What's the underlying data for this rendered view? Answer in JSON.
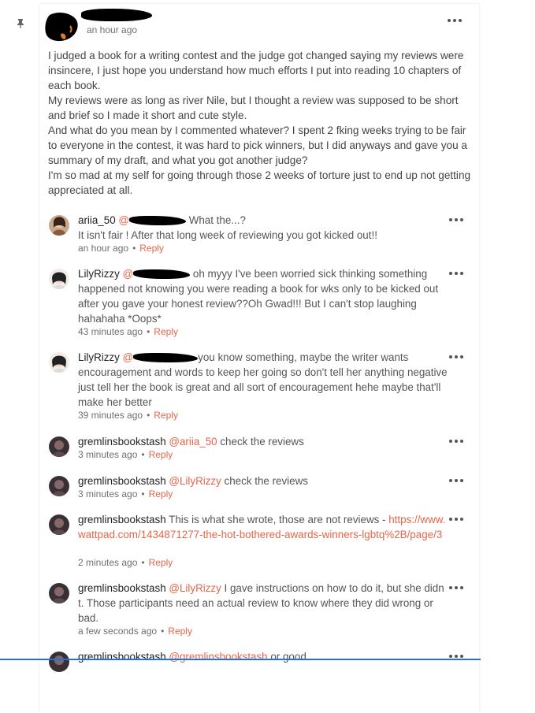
{
  "main": {
    "time": "an hour ago",
    "body": "I judged a book for a writing contest and the judge got changed saying my reviews were insincere, I just hope you understand how much efforts I put into reading 10 chapters of each book.\nMy reviews were as long as river Nile, but I thought a review was supposed to be short and brief so I made it short and cute style.\nAnd what do you mean by I commented whatever? I spent 2 fking weeks trying to be fair to everyone in the contest, it was hard to pick winners, but I did anyways and gave you a summary of my draft, and what you got another judge?\nI'm so mad at my self for going through those 2 weeks of torture just to end up not getting appreciated at all."
  },
  "comments": [
    {
      "user": "ariia_50",
      "mention": "@",
      "text": " What the...?\nIt isn't fair ! After that long week of reviewing you got kicked out!!",
      "time": "an hour ago",
      "reply": "Reply"
    },
    {
      "user": "LilyRizzy",
      "mention": "@",
      "text": " oh myyy I've been worried sick thinking something happened not knowing you were reading a book for wks only to be kicked out after you gave your honest review??Oh Gwad!!! But I can't stop laughing hahahaha *Oops*",
      "time": "43 minutes ago",
      "reply": "Reply"
    },
    {
      "user": "LilyRizzy",
      "mention": "@",
      "text": "you know something, maybe the writer wants encouragement and words to keep her going so  don't tell her anything negative just tell her the book is great and all sort of encouragement hehe maybe that'll make her better",
      "time": "39 minutes ago",
      "reply": "Reply"
    },
    {
      "user": "gremlinsbookstash",
      "mention": "@ariia_50",
      "text": " check the reviews",
      "time": "3 minutes ago",
      "reply": "Reply"
    },
    {
      "user": "gremlinsbookstash",
      "mention": "@LilyRizzy",
      "text": " check the reviews",
      "time": "3 minutes ago",
      "reply": "Reply"
    },
    {
      "user": "gremlinsbookstash",
      "text": " This is what she wrote, those are not reviews - ",
      "link": "https://www.wattpad.com/1434871277-the-hot-bothered-awards-winners-lgbtq%2B/page/3",
      "time": "2 minutes ago",
      "reply": "Reply"
    },
    {
      "user": "gremlinsbookstash",
      "mention": "@LilyRizzy",
      "text": " I gave instructions on how to do it, but she didn t. Those participants need an actual review to know where they did wrong or bad.",
      "time": "a few seconds ago",
      "reply": "Reply"
    },
    {
      "user": "gremlinsbookstash",
      "mention": "@gremlinsbookstash",
      "text": " or good"
    }
  ],
  "meta_separator": "•"
}
